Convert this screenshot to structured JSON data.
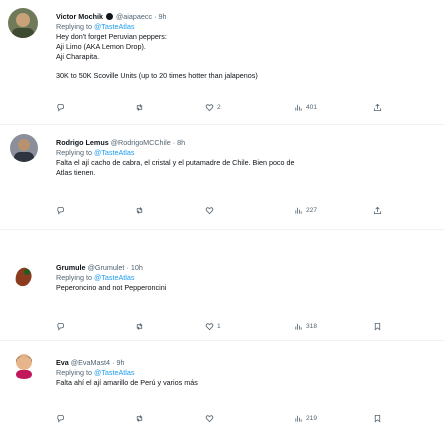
{
  "tweets": [
    {
      "name": "Victor Mochik",
      "handle": "@aiapaecc",
      "sep": "·",
      "time": "9h",
      "reply_prefix": "Replying to",
      "reply_to": "@TasteAtlas",
      "text": "Hey don't forget Peruvian peppers:\nAji Limo (AKA Lemon Drop).\nAji Charapita.",
      "text2": "30K to 50K Scoville Units (up to 20 times hotter than jalapenos)",
      "stats": {
        "replies": "",
        "retweets": "",
        "likes": "2",
        "views": "401"
      }
    },
    {
      "name": "Rodrigo Lemus",
      "handle": "@RodrigoMCChile",
      "sep": "·",
      "time": "8h",
      "reply_prefix": "Replying to",
      "reply_to": "@TasteAtlas",
      "text": "Falta el ají cacho de cabra, el cristal y el putamadre de Chile. Bien poco de\nAtlas tienen.",
      "stats": {
        "replies": "",
        "retweets": "",
        "likes": "",
        "views": "227"
      }
    },
    {
      "name": "Grumule",
      "handle": "@Grumulet",
      "sep": "·",
      "time": "10h",
      "reply_prefix": "Replying to",
      "reply_to": "@TasteAtlas",
      "text": "Peperoncino and not Pepperoncini",
      "stats": {
        "replies": "",
        "retweets": "",
        "likes": "1",
        "views": "318"
      }
    },
    {
      "name": "Eva",
      "handle": "@EvaMast4",
      "sep": "·",
      "time": "9h",
      "reply_prefix": "Replying to",
      "reply_to": "@TasteAtlas",
      "text": "Falta ahí el ají amarillo de Perú y varios más",
      "stats": {
        "replies": "",
        "retweets": "",
        "likes": "",
        "views": "219"
      }
    }
  ],
  "icons": {
    "reply": "reply-icon",
    "retweet": "retweet-icon",
    "like": "heart-icon",
    "views": "views-icon",
    "share": "share-icon",
    "bookmark": "bookmark-icon"
  },
  "colors": {
    "text": "#0f1419",
    "secondary": "#536471",
    "link": "#1d9bf0",
    "divider": "#eff3f4"
  }
}
